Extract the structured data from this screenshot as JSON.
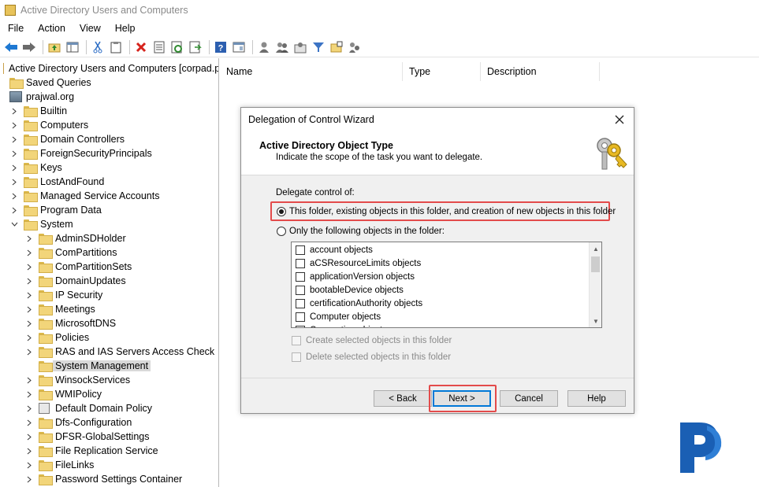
{
  "window": {
    "title": "Active Directory Users and Computers"
  },
  "menu": [
    "File",
    "Action",
    "View",
    "Help"
  ],
  "toolbar_icons": [
    "back-icon",
    "forward-icon",
    "up-folder-icon",
    "show-hide-tree-icon",
    "cut-icon",
    "paste-icon",
    "delete-icon",
    "properties-icon",
    "refresh-icon",
    "export-icon",
    "help-icon",
    "console-icon",
    "user-icon",
    "users-icon",
    "group-icon",
    "filter-icon",
    "folder-add-icon",
    "delegate-icon"
  ],
  "tree": {
    "root": "Active Directory Users and Computers [corpad.pra",
    "saved_queries": "Saved Queries",
    "domain": "prajwal.org",
    "level1": [
      "Builtin",
      "Computers",
      "Domain Controllers",
      "ForeignSecurityPrincipals",
      "Keys",
      "LostAndFound",
      "Managed Service Accounts",
      "Program Data",
      "System"
    ],
    "system_children": [
      "AdminSDHolder",
      "ComPartitions",
      "ComPartitionSets",
      "DomainUpdates",
      "IP Security",
      "Meetings",
      "MicrosoftDNS",
      "Policies",
      "RAS and IAS Servers Access Check",
      "System Management",
      "WinsockServices",
      "WMIPolicy",
      "Default Domain Policy",
      "Dfs-Configuration",
      "DFSR-GlobalSettings",
      "File Replication Service",
      "FileLinks",
      "Password Settings Container"
    ],
    "selected": "System Management"
  },
  "columns": [
    "Name",
    "Type",
    "Description"
  ],
  "dialog": {
    "title": "Delegation of Control Wizard",
    "header_title": "Active Directory Object Type",
    "header_subtitle": "Indicate the scope of the task you want to delegate.",
    "delegate_label": "Delegate control of:",
    "option_all": "This folder, existing objects in this folder, and creation of new objects in this folder",
    "option_only": "Only the following objects in the folder:",
    "objects": [
      "account objects",
      "aCSResourceLimits objects",
      "applicationVersion objects",
      "bootableDevice objects",
      "certificationAuthority objects",
      "Computer objects",
      "Connection objects"
    ],
    "create_label": "Create selected objects in this folder",
    "delete_label": "Delete selected objects in this folder",
    "buttons": {
      "back": "< Back",
      "next": "Next >",
      "cancel": "Cancel",
      "help": "Help"
    },
    "highlight_color": "#e34b4b"
  },
  "brand": {
    "logo_letter": "P",
    "color": "#1a5fb4"
  }
}
